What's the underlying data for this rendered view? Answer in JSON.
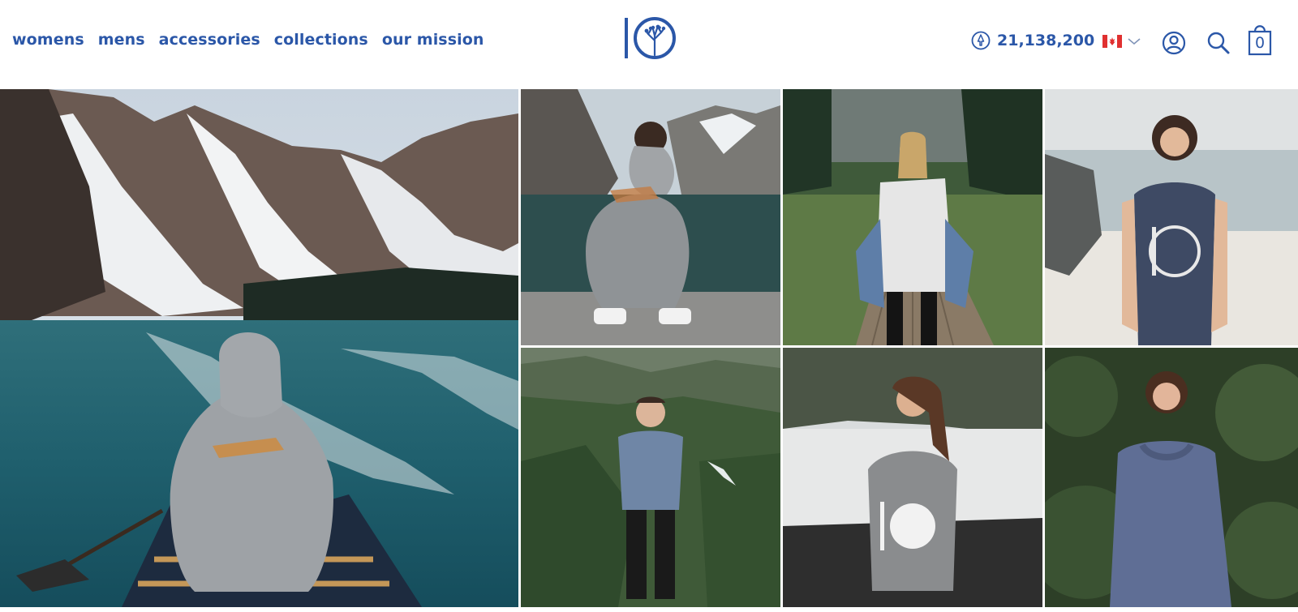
{
  "nav": {
    "items": [
      "womens",
      "mens",
      "accessories",
      "collections",
      "our mission"
    ]
  },
  "brand": {
    "logo_text": "IO",
    "color": "#2b57a8"
  },
  "header_right": {
    "tree_counter": "21,138,200",
    "country": "Canada",
    "cart_count": "0"
  },
  "icons": {
    "tree": "tree-icon",
    "flag": "canada-flag-icon",
    "chevron": "chevron-down-icon",
    "account": "user-icon",
    "search": "search-icon",
    "cart": "shopping-bag-icon"
  },
  "gallery": {
    "tiles": [
      "canoe-mountain-lake",
      "man-crouching-lake-hoodie",
      "woman-boardwalk-tee",
      "woman-beach-tank",
      "man-hills-tee",
      "woman-coast-tank",
      "woman-foliage-hoodie"
    ]
  }
}
